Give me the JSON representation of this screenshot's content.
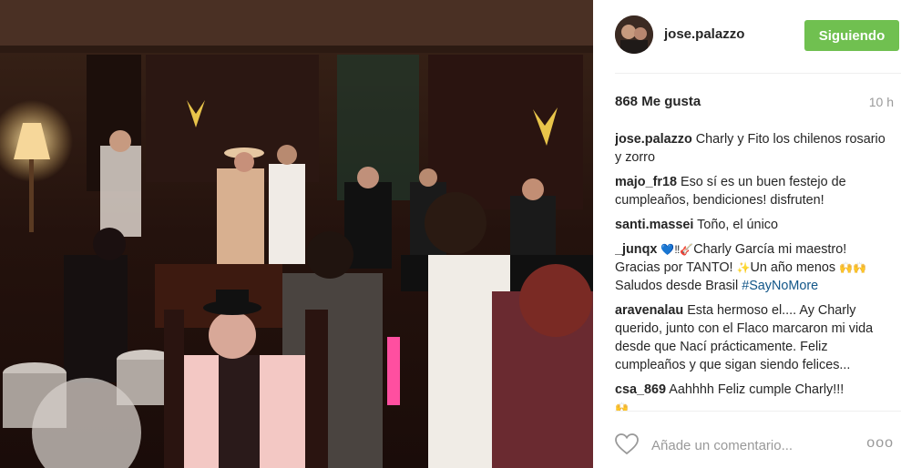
{
  "header": {
    "username": "jose.palazzo",
    "follow_label": "Siguiendo"
  },
  "stats": {
    "likes": "868 Me gusta",
    "time_ago": "10 h"
  },
  "comments": [
    {
      "user": "jose.palazzo",
      "text": "Charly y Fito los chilenos rosario y zorro"
    },
    {
      "user": "majo_fr18",
      "text": "Eso sí es un buen festejo de cumpleaños, bendiciones! disfruten!"
    },
    {
      "user": "santi.massei",
      "text": "Toño, el único"
    },
    {
      "user": "_junqx",
      "emoji_a": "💙‼🎸",
      "text_a": "Charly García mi maestro! Gracias por TANTO! ",
      "emoji_b": "✨",
      "text_b": "Un año menos ",
      "emoji_c": "🙌",
      "emoji_d": "🙌",
      "text_c": " Saludos desde Brasil ",
      "hashtag": "#SayNoMore"
    },
    {
      "user": "aravenalau",
      "text": "Esta hermoso el.... Ay Charly querido, junto con el Flaco marcaron mi vida desde que Nací prácticamente. Feliz cumpleaños y que sigan siendo felices..."
    },
    {
      "user": "csa_869",
      "text": "Aahhhh Feliz cumple Charly!!!",
      "emoji": "🙌"
    }
  ],
  "add_comment": {
    "placeholder": "Añade un comentario...",
    "more_label": "ooo"
  },
  "colors": {
    "follow_green": "#70c050",
    "hashtag_blue": "#125688",
    "muted_gray": "#999999"
  },
  "icons": [
    "heart-icon",
    "more-options-icon"
  ]
}
